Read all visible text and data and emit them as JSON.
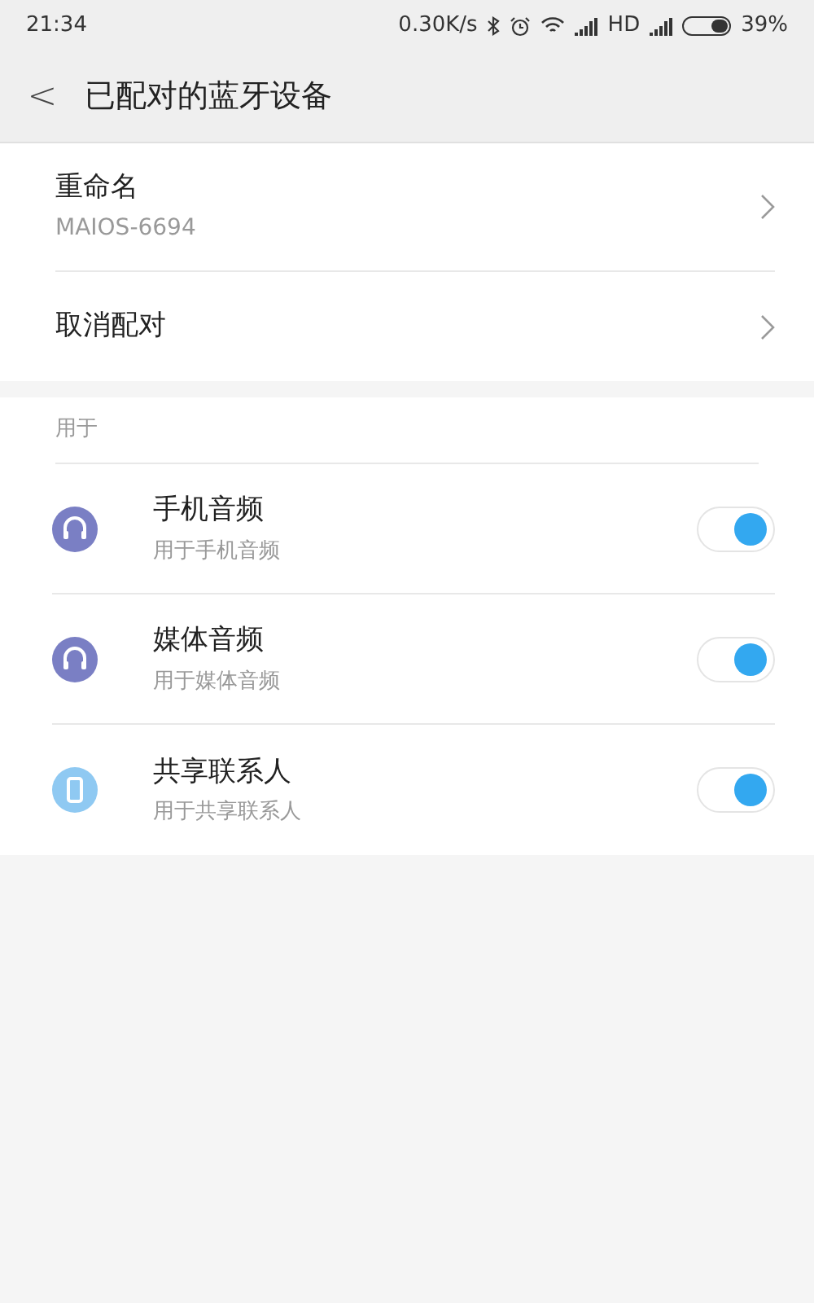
{
  "status_bar": {
    "time": "21:34",
    "speed": "0.30K/s",
    "network": "HD",
    "battery": "39%"
  },
  "header": {
    "back": "<",
    "title": "已配对的蓝牙设备"
  },
  "device_actions": [
    {
      "label": "重命名",
      "value": "MAIOS-6694"
    },
    {
      "label": "取消配对"
    }
  ],
  "section": {
    "title": "用于",
    "items": [
      {
        "kind": "headphones",
        "color": "#7a7fc4",
        "title": "手机音频",
        "subtitle": "用于手机音频",
        "on": true
      },
      {
        "kind": "headphones",
        "color": "#7a7fc4",
        "title": "媒体音频",
        "subtitle": "用于媒体音频",
        "on": true
      },
      {
        "kind": "phone",
        "color": "#8fc9f2",
        "title": "共享联系人",
        "subtitle": "用于共享联系人",
        "on": true
      }
    ]
  }
}
